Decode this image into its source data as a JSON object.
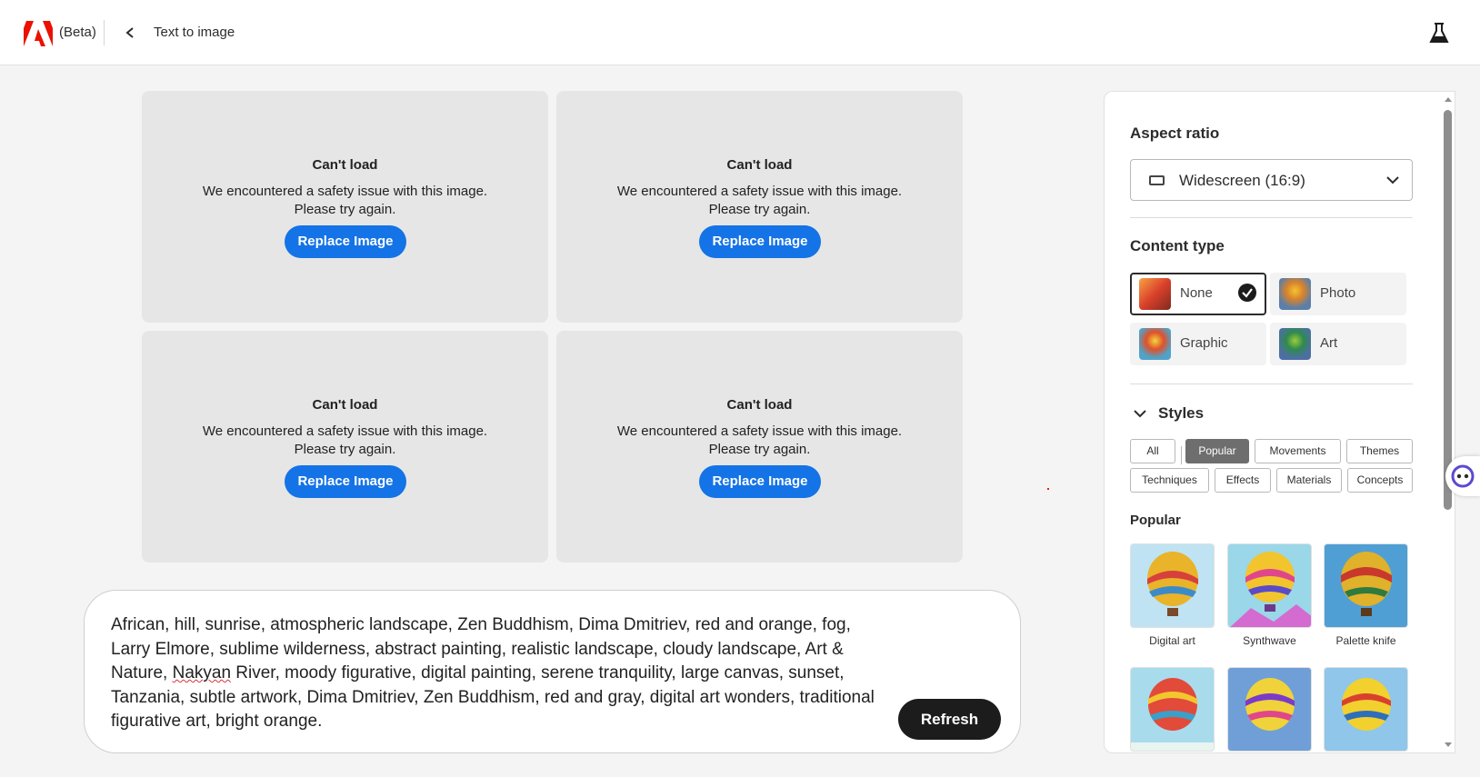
{
  "header": {
    "beta_label": "(Beta)",
    "title": "Text to image",
    "icons": [
      "adobe-logo",
      "chevron-left-icon",
      "flask-icon"
    ]
  },
  "results": {
    "cards": [
      {
        "title": "Can't load",
        "message_line1": "We encountered a safety issue with this image.",
        "message_line2": "Please try again.",
        "button": "Replace Image"
      },
      {
        "title": "Can't load",
        "message_line1": "We encountered a safety issue with this image.",
        "message_line2": "Please try again.",
        "button": "Replace Image"
      },
      {
        "title": "Can't load",
        "message_line1": "We encountered a safety issue with this image.",
        "message_line2": "Please try again.",
        "button": "Replace Image"
      },
      {
        "title": "Can't load",
        "message_line1": "We encountered a safety issue with this image.",
        "message_line2": "Please try again.",
        "button": "Replace Image"
      }
    ]
  },
  "prompt": {
    "text_before": "African, hill, sunrise, atmospheric landscape, Zen Buddhism, Dima Dmitriev, red and orange, fog, Larry Elmore, sublime wilderness, abstract painting, realistic landscape, cloudy landscape, Art & Nature, ",
    "misspelled": "Nakyan",
    "text_after": " River, moody figurative, digital painting, serene tranquility, large canvas, sunset, Tanzania, subtle artwork, Dima Dmitriev, Zen Buddhism, red and gray, digital art wonders, traditional figurative art, bright orange.",
    "refresh_label": "Refresh"
  },
  "panel": {
    "aspect_ratio": {
      "title": "Aspect ratio",
      "value": "Widescreen (16:9)"
    },
    "content_type": {
      "title": "Content type",
      "options": [
        {
          "label": "None",
          "selected": true
        },
        {
          "label": "Photo",
          "selected": false
        },
        {
          "label": "Graphic",
          "selected": false
        },
        {
          "label": "Art",
          "selected": false
        }
      ]
    },
    "styles": {
      "title": "Styles",
      "filters": [
        {
          "label": "All",
          "active": false
        },
        {
          "label": "Popular",
          "active": true
        },
        {
          "label": "Movements",
          "active": false
        },
        {
          "label": "Themes",
          "active": false
        },
        {
          "label": "Techniques",
          "active": false
        },
        {
          "label": "Effects",
          "active": false
        },
        {
          "label": "Materials",
          "active": false
        },
        {
          "label": "Concepts",
          "active": false
        }
      ],
      "section_title": "Popular",
      "tiles": [
        {
          "label": "Digital art"
        },
        {
          "label": "Synthwave"
        },
        {
          "label": "Palette knife"
        },
        {
          "label": ""
        },
        {
          "label": ""
        },
        {
          "label": ""
        }
      ]
    }
  },
  "colors": {
    "accent_blue": "#1473e6",
    "adobe_red": "#eb1000",
    "dark_button": "#1c1c1c",
    "card_bg": "#e6e6e6",
    "chip_active": "#6e6e6e"
  }
}
